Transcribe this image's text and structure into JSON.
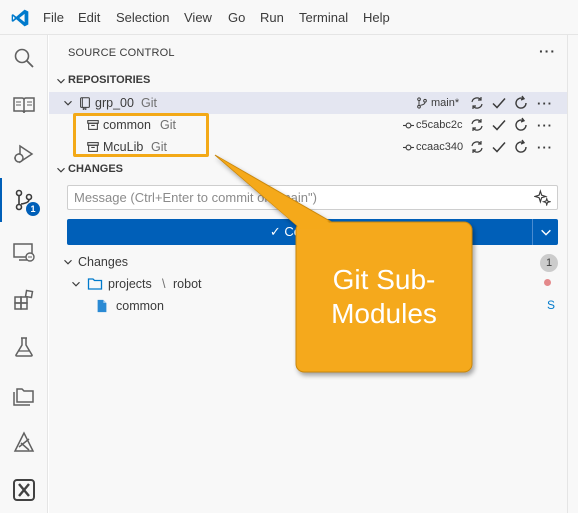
{
  "menubar": {
    "items": [
      "File",
      "Edit",
      "Selection",
      "View",
      "Go",
      "Run",
      "Terminal",
      "Help"
    ]
  },
  "activitybar": {
    "items": [
      "explorer-icon",
      "book-icon",
      "run-debug-icon",
      "source-control-icon",
      "remote-explorer-icon",
      "extensions-icon",
      "testing-icon",
      "folders-icon",
      "deploy-icon",
      "x-icon"
    ],
    "scm_badge": "1"
  },
  "panel": {
    "title": "SOURCE CONTROL",
    "more": "···"
  },
  "repositories": {
    "header": "REPOSITORIES",
    "items": [
      {
        "name": "grp_00",
        "provider": "Git",
        "branch": "main*"
      },
      {
        "name": "common",
        "provider": "Git",
        "branch": "c5cabc2c"
      },
      {
        "name": "McuLib",
        "provider": "Git",
        "branch": "ccaac340"
      }
    ]
  },
  "changes_section": {
    "header": "CHANGES",
    "message_placeholder": "Message (Ctrl+Enter to commit on \"main\")",
    "commit_label": "✓ Commit",
    "group_label": "Changes",
    "count": "1",
    "folder": "projects",
    "folder_sep": "\\",
    "folder_child": "robot",
    "file": "common",
    "file_status": "S"
  },
  "callout": {
    "line1": "Git Sub-",
    "line2": "Modules"
  },
  "colors": {
    "accent": "#005fb8",
    "callout": "#f3a917",
    "selection": "#e4e6f1"
  }
}
